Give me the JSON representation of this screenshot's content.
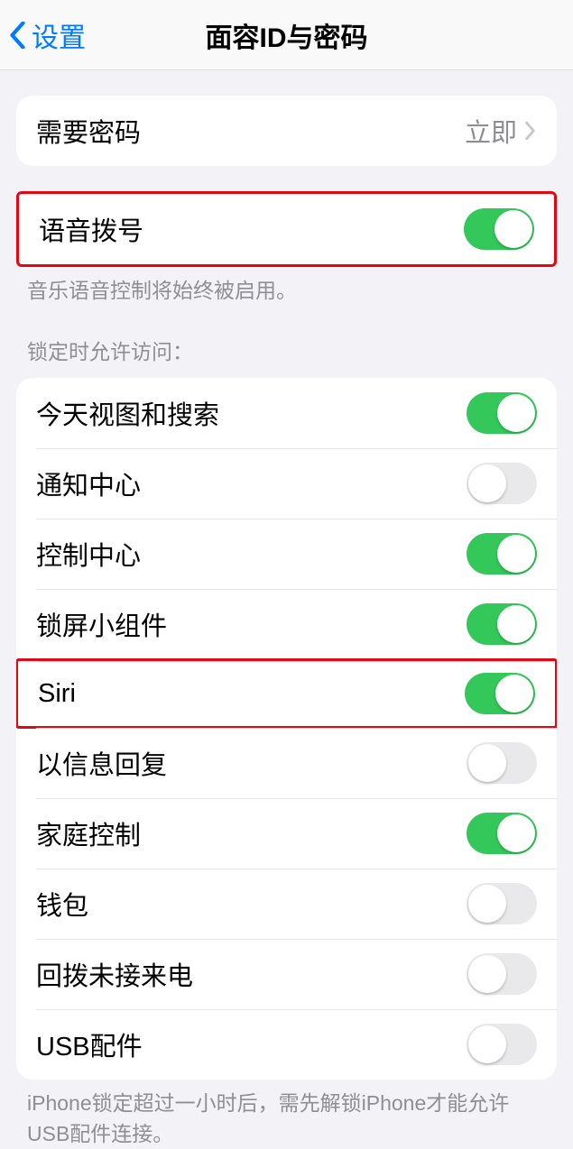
{
  "nav": {
    "back_label": "设置",
    "title": "面容ID与密码"
  },
  "passcode": {
    "label": "需要密码",
    "value": "立即"
  },
  "voice_dial": {
    "label": "语音拨号",
    "enabled": true,
    "footer": "音乐语音控制将始终被启用。"
  },
  "lock_access_header": "锁定时允许访问：",
  "lock_items": [
    {
      "label": "今天视图和搜索",
      "on": true
    },
    {
      "label": "通知中心",
      "on": false
    },
    {
      "label": "控制中心",
      "on": true
    },
    {
      "label": "锁屏小组件",
      "on": true
    },
    {
      "label": "Siri",
      "on": true,
      "highlight": true
    },
    {
      "label": "以信息回复",
      "on": false
    },
    {
      "label": "家庭控制",
      "on": true
    },
    {
      "label": "钱包",
      "on": false
    },
    {
      "label": "回拨未接来电",
      "on": false
    },
    {
      "label": "USB配件",
      "on": false
    }
  ],
  "usb_footer": "iPhone锁定超过一小时后，需先解锁iPhone才能允许USB配件连接。"
}
